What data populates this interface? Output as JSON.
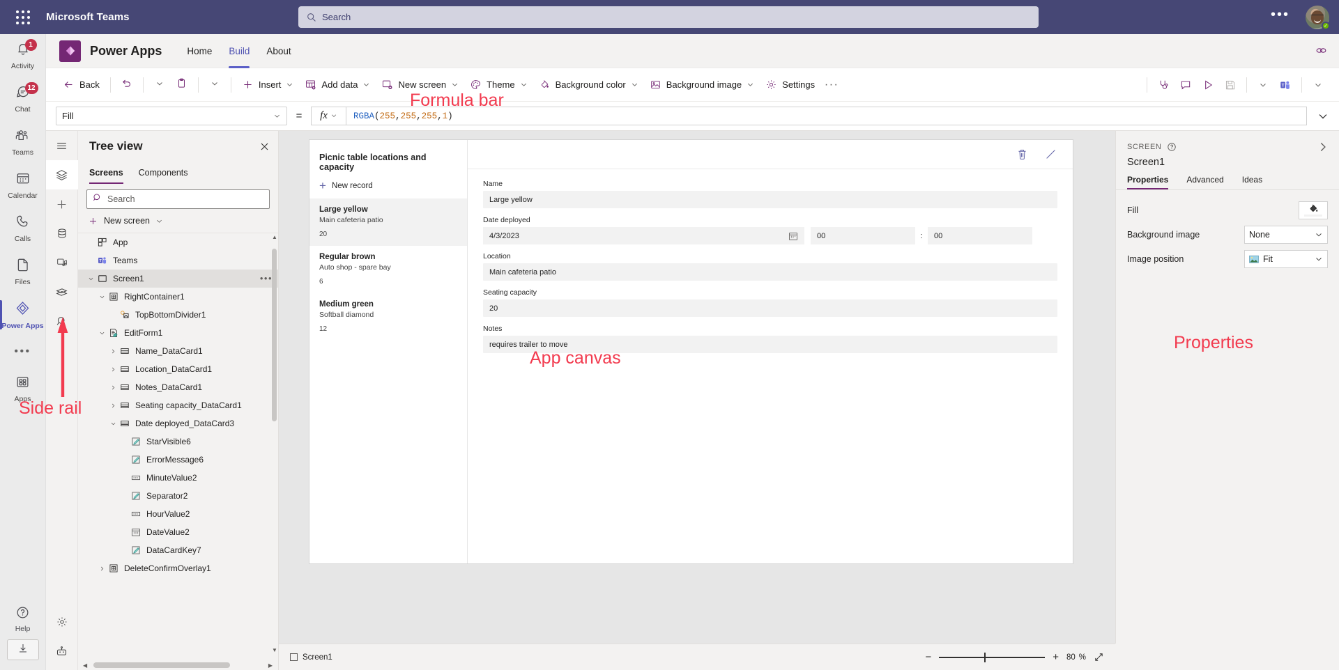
{
  "teams": {
    "title": "Microsoft Teams",
    "search": {
      "placeholder": "Search",
      "icon": "search-icon"
    },
    "more_label": "•••",
    "rail": [
      {
        "label": "Activity",
        "icon": "bell-icon",
        "badge": "1"
      },
      {
        "label": "Chat",
        "icon": "chat-icon",
        "badge": "12"
      },
      {
        "label": "Teams",
        "icon": "teams-icon",
        "badge": ""
      },
      {
        "label": "Calendar",
        "icon": "calendar-icon",
        "badge": ""
      },
      {
        "label": "Calls",
        "icon": "phone-icon",
        "badge": ""
      },
      {
        "label": "Files",
        "icon": "file-icon",
        "badge": ""
      },
      {
        "label": "Power Apps",
        "icon": "power-apps-icon",
        "badge": ""
      }
    ],
    "rail_more": "•••",
    "rail_apps": {
      "label": "Apps",
      "icon": "apps-grid-icon"
    },
    "rail_help": {
      "label": "Help",
      "icon": "question-circle-icon"
    },
    "rail_download": {
      "label": "",
      "icon": "download-icon"
    }
  },
  "power_apps_header": {
    "product_name": "Power Apps",
    "logo_icon": "power-apps-logo-icon",
    "nav": [
      {
        "label": "Home",
        "active": false
      },
      {
        "label": "Build",
        "active": true
      },
      {
        "label": "About",
        "active": false
      }
    ],
    "link_icon": "link-icon"
  },
  "command_bar": {
    "back": {
      "label": "Back",
      "icon": "arrow-left-icon"
    },
    "undo": {
      "icon": "undo-icon"
    },
    "undo_chevron": {
      "icon": "chevron-down-icon"
    },
    "paste": {
      "icon": "clipboard-icon"
    },
    "paste_chevron": {
      "icon": "chevron-down-icon"
    },
    "items": [
      {
        "label": "Insert",
        "icon": "plus-icon",
        "chevron": true
      },
      {
        "label": "Add data",
        "icon": "add-data-icon",
        "chevron": true
      },
      {
        "label": "New screen",
        "icon": "new-screen-icon",
        "chevron": true
      },
      {
        "label": "Theme",
        "icon": "theme-palette-icon",
        "chevron": true
      },
      {
        "label": "Background color",
        "icon": "background-color-icon",
        "chevron": true
      },
      {
        "label": "Background image",
        "icon": "background-image-icon",
        "chevron": true
      },
      {
        "label": "Settings",
        "icon": "gear-icon",
        "chevron": false
      }
    ],
    "overflow": "···",
    "right_icons": [
      {
        "name": "app-checker-icon"
      },
      {
        "name": "comments-icon"
      },
      {
        "name": "preview-play-icon"
      },
      {
        "name": "save-icon"
      },
      {
        "name": "chevron-down-icon"
      },
      {
        "name": "teams-publish-icon"
      },
      {
        "name": "chevron-down-icon"
      }
    ]
  },
  "formula_bar": {
    "property": "Fill",
    "equals": "=",
    "fx_label": "fx",
    "formula": {
      "function_name": "RGBA",
      "open_paren": "(",
      "args": [
        "255",
        "255",
        "255",
        "1"
      ],
      "separator": ", ",
      "close_paren": ")",
      "full_text": "RGBA(255, 255, 255, 1)"
    },
    "expand_icon": "chevron-down-icon"
  },
  "studio_rail": [
    {
      "name": "hamburger-menu-icon",
      "selected": false
    },
    {
      "name": "tree-view-layers-icon",
      "selected": true
    },
    {
      "name": "insert-plus-icon",
      "selected": false
    },
    {
      "name": "data-cylinder-icon",
      "selected": false
    },
    {
      "name": "media-icon",
      "selected": false
    },
    {
      "name": "power-automate-icon",
      "selected": false
    },
    {
      "name": "search-icon",
      "selected": false
    },
    {
      "name": "settings-gear-icon",
      "selected": false
    },
    {
      "name": "copilot-robot-icon",
      "selected": false
    }
  ],
  "tree_view": {
    "title": "Tree view",
    "close_icon": "close-icon",
    "tabs": [
      {
        "label": "Screens",
        "active": true
      },
      {
        "label": "Components",
        "active": false
      }
    ],
    "search": {
      "placeholder": "Search",
      "icon": "search-icon"
    },
    "new_screen": {
      "label": "New screen",
      "icon": "plus-icon",
      "chevron": "chevron-down-icon"
    },
    "nodes": [
      {
        "label": "App",
        "indent": 0,
        "twist": "",
        "icon": "app-icon",
        "selected": false,
        "dots": false
      },
      {
        "label": "Teams",
        "indent": 0,
        "twist": "",
        "icon": "teams-icon",
        "selected": false,
        "dots": false
      },
      {
        "label": "Screen1",
        "indent": 0,
        "twist": "down",
        "icon": "screen-icon",
        "selected": true,
        "dots": true
      },
      {
        "label": "RightContainer1",
        "indent": 1,
        "twist": "down",
        "icon": "container-icon",
        "selected": false,
        "dots": false
      },
      {
        "label": "TopBottomDivider1",
        "indent": 2,
        "twist": "",
        "icon": "divider-icon",
        "selected": false,
        "dots": false
      },
      {
        "label": "EditForm1",
        "indent": 1,
        "twist": "down",
        "icon": "form-icon",
        "selected": false,
        "dots": false
      },
      {
        "label": "Name_DataCard1",
        "indent": 2,
        "twist": "right",
        "icon": "datacard-icon",
        "selected": false,
        "dots": false
      },
      {
        "label": "Location_DataCard1",
        "indent": 2,
        "twist": "right",
        "icon": "datacard-icon",
        "selected": false,
        "dots": false
      },
      {
        "label": "Notes_DataCard1",
        "indent": 2,
        "twist": "right",
        "icon": "datacard-icon",
        "selected": false,
        "dots": false
      },
      {
        "label": "Seating capacity_DataCard1",
        "indent": 2,
        "twist": "right",
        "icon": "datacard-icon",
        "selected": false,
        "dots": false
      },
      {
        "label": "Date deployed_DataCard3",
        "indent": 2,
        "twist": "down",
        "icon": "datacard-icon",
        "selected": false,
        "dots": false
      },
      {
        "label": "StarVisible6",
        "indent": 3,
        "twist": "",
        "icon": "label-pencil-icon",
        "selected": false,
        "dots": false
      },
      {
        "label": "ErrorMessage6",
        "indent": 3,
        "twist": "",
        "icon": "label-pencil-icon",
        "selected": false,
        "dots": false
      },
      {
        "label": "MinuteValue2",
        "indent": 3,
        "twist": "",
        "icon": "dropdown-icon",
        "selected": false,
        "dots": false
      },
      {
        "label": "Separator2",
        "indent": 3,
        "twist": "",
        "icon": "label-pencil-icon",
        "selected": false,
        "dots": false
      },
      {
        "label": "HourValue2",
        "indent": 3,
        "twist": "",
        "icon": "dropdown-icon",
        "selected": false,
        "dots": false
      },
      {
        "label": "DateValue2",
        "indent": 3,
        "twist": "",
        "icon": "date-picker-icon",
        "selected": false,
        "dots": false
      },
      {
        "label": "DataCardKey7",
        "indent": 3,
        "twist": "",
        "icon": "label-pencil-icon",
        "selected": false,
        "dots": false
      },
      {
        "label": "DeleteConfirmOverlay1",
        "indent": 1,
        "twist": "right",
        "icon": "container-icon",
        "selected": false,
        "dots": false
      }
    ]
  },
  "canvas": {
    "gallery": {
      "title": "Picnic table locations and capacity",
      "new_record": {
        "label": "New record",
        "icon": "plus-icon"
      },
      "items": [
        {
          "name": "Large yellow",
          "location": "Main cafeteria patio",
          "capacity": "20",
          "selected": true
        },
        {
          "name": "Regular brown",
          "location": "Auto shop - spare bay",
          "capacity": "6",
          "selected": false
        },
        {
          "name": "Medium green",
          "location": "Softball diamond",
          "capacity": "12",
          "selected": false
        }
      ]
    },
    "form": {
      "actions": [
        {
          "name": "delete-icon"
        },
        {
          "name": "edit-pencil-icon"
        }
      ],
      "fields": [
        {
          "label": "Name",
          "value": "Large yellow",
          "type": "text"
        },
        {
          "label": "Date deployed",
          "value": "4/3/2023",
          "type": "datetime",
          "hour": "00",
          "minute": "00",
          "colon": ":",
          "calendar_icon": "calendar-icon"
        },
        {
          "label": "Location",
          "value": "Main cafeteria patio",
          "type": "text"
        },
        {
          "label": "Seating capacity",
          "value": "20",
          "type": "text"
        },
        {
          "label": "Notes",
          "value": "requires trailer to move",
          "type": "text"
        }
      ]
    }
  },
  "properties_panel": {
    "kind": "SCREEN",
    "help_icon": "question-circle-icon",
    "expand_icon": "chevron-right-icon",
    "name": "Screen1",
    "tabs": [
      {
        "label": "Properties",
        "active": true
      },
      {
        "label": "Advanced",
        "active": false
      },
      {
        "label": "Ideas",
        "active": false
      }
    ],
    "rows": [
      {
        "key": "Fill",
        "control": "color-swatch",
        "value": "",
        "icon": "paint-bucket-icon"
      },
      {
        "key": "Background image",
        "control": "dropdown",
        "value": "None",
        "icon": ""
      },
      {
        "key": "Image position",
        "control": "dropdown",
        "value": "Fit",
        "icon": "image-icon"
      }
    ]
  },
  "status_bar": {
    "screen_label": "Screen1",
    "screen_icon": "screen-icon",
    "zoom_out": "−",
    "zoom_in": "+",
    "zoom_value": "80",
    "zoom_unit": "%",
    "fit_icon": "fit-screen-icon"
  },
  "annotations": [
    {
      "id": "formula-bar",
      "text": "Formula bar"
    },
    {
      "id": "app-canvas",
      "text": "App canvas"
    },
    {
      "id": "properties",
      "text": "Properties"
    },
    {
      "id": "side-rail",
      "text": "Side rail"
    }
  ],
  "colors": {
    "teams_purple": "#464775",
    "accent_purple": "#742774",
    "nav_active": "#5b5fc7",
    "badge_red": "#c4314b",
    "annotation_red": "#f23b4f"
  }
}
